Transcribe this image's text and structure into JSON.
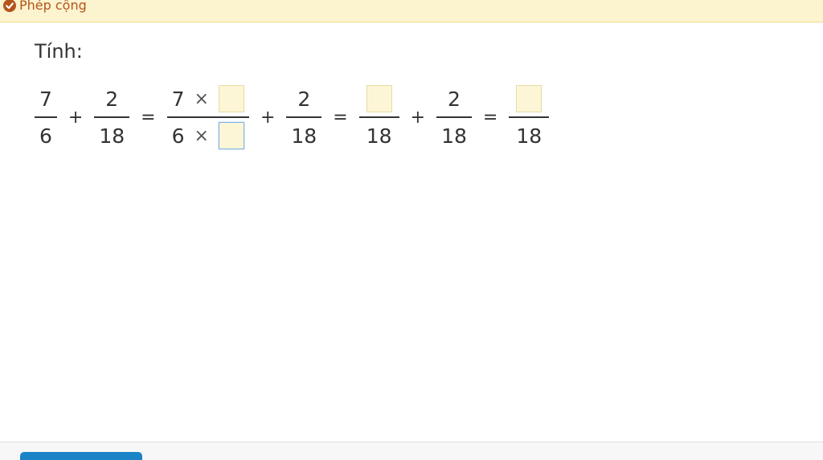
{
  "header": {
    "title": "Phép cộng",
    "icon": "check-circle-icon",
    "accent": "#b4541a"
  },
  "prompt": "Tính:",
  "equation": {
    "f1": {
      "num": "7",
      "den": "6"
    },
    "op1": "+",
    "f2": {
      "num": "2",
      "den": "18"
    },
    "eq1": "=",
    "f3": {
      "num": "7",
      "den": "6",
      "times": "×"
    },
    "op2": "+",
    "f4": {
      "num": "2",
      "den": "18"
    },
    "eq2": "=",
    "f5": {
      "den": "18"
    },
    "op3": "+",
    "f6": {
      "num": "2",
      "den": "18"
    },
    "eq3": "=",
    "f7": {
      "den": "18"
    }
  },
  "footer": {
    "button_color": "#1a84c7"
  }
}
